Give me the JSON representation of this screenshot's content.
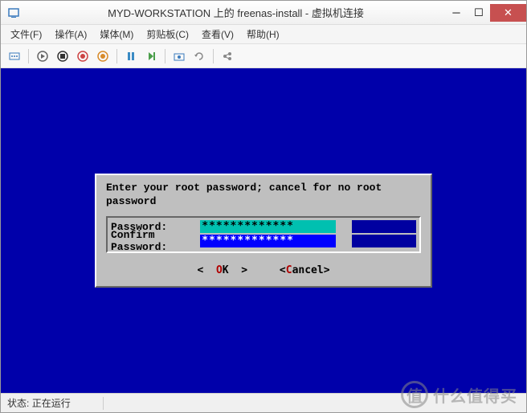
{
  "window": {
    "title": "MYD-WORKSTATION 上的 freenas-install - 虚拟机连接"
  },
  "menu": {
    "file": "文件(F)",
    "action": "操作(A)",
    "media": "媒体(M)",
    "clipboard": "剪贴板(C)",
    "view": "查看(V)",
    "help": "帮助(H)"
  },
  "dialog": {
    "prompt": "Enter your root password; cancel for no root password",
    "password_label": "Password:",
    "confirm_label": "Confirm Password:",
    "password_value": "*************",
    "confirm_value": "*************",
    "ok_hot": "O",
    "ok_rest": "K",
    "cancel_hot": "C",
    "cancel_rest": "ancel"
  },
  "status": {
    "label": "状态:",
    "value": "正在运行"
  },
  "watermark": {
    "icon": "值",
    "text": "什么值得买"
  }
}
